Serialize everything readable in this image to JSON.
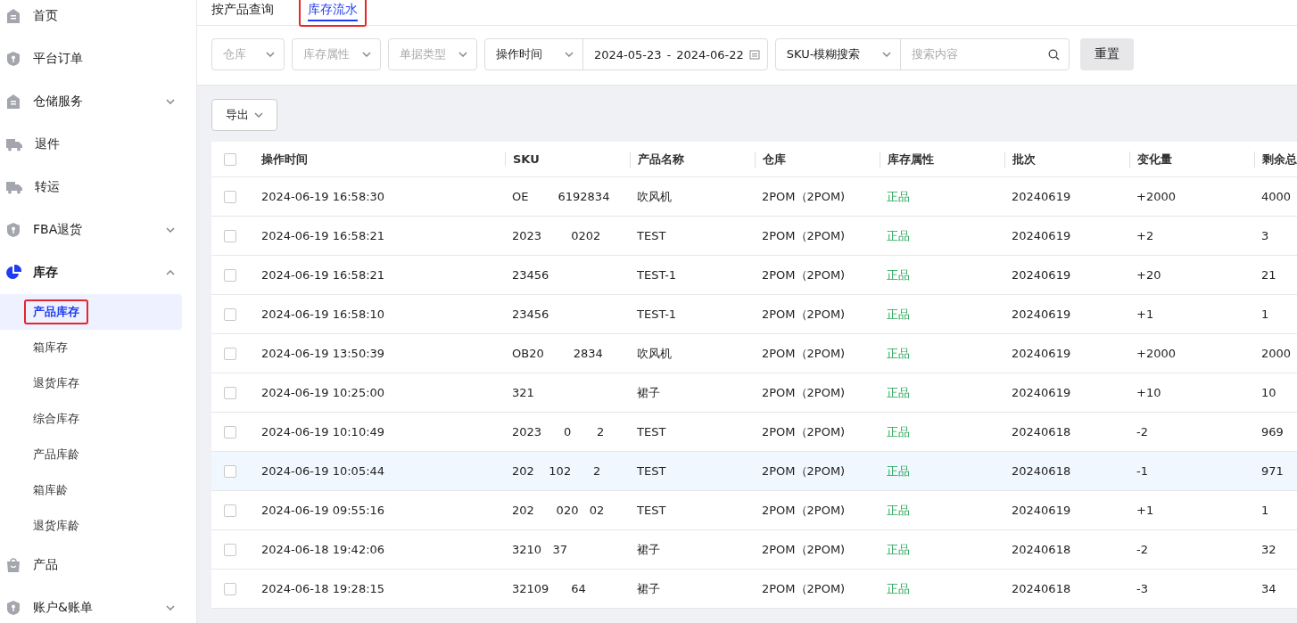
{
  "sidebar": {
    "items": [
      {
        "label": "首页",
        "active": false
      },
      {
        "label": "平台订单",
        "active": false
      },
      {
        "label": "仓储服务",
        "expanded": false,
        "active": false
      },
      {
        "label": "退件",
        "active": false
      },
      {
        "label": "转运",
        "active": false
      },
      {
        "label": "FBA退货",
        "expanded": false,
        "active": false
      },
      {
        "label": "库存",
        "expanded": true,
        "active": true,
        "children": [
          {
            "label": "产品库存",
            "selected": true,
            "annotated": true
          },
          {
            "label": "箱库存",
            "selected": false
          },
          {
            "label": "退货库存",
            "selected": false
          },
          {
            "label": "综合库存",
            "selected": false
          },
          {
            "label": "产品库龄",
            "selected": false
          },
          {
            "label": "箱库龄",
            "selected": false
          },
          {
            "label": "退货库龄",
            "selected": false
          }
        ]
      },
      {
        "label": "产品",
        "active": false
      },
      {
        "label": "账户&账单",
        "expanded": false,
        "active": false
      }
    ]
  },
  "tabs": [
    {
      "label": "按产品查询",
      "selected": false
    },
    {
      "label": "库存流水",
      "selected": true,
      "annotated": true
    }
  ],
  "filters": {
    "selects": [
      {
        "placeholder": "仓库"
      },
      {
        "placeholder": "库存属性"
      },
      {
        "placeholder": "单据类型"
      }
    ],
    "time_type": "操作时间",
    "date_start": "2024-05-23",
    "date_separator": "-",
    "date_end": "2024-06-22",
    "search_type": "SKU-模糊搜索",
    "search_placeholder": "搜索内容",
    "reset": "重置"
  },
  "export": "导出",
  "table": {
    "select_all_checked": false,
    "columns": [
      "操作时间",
      "SKU",
      "产品名称",
      "仓库",
      "库存属性",
      "批次",
      "变化量",
      "剩余总"
    ],
    "rows": [
      {
        "cells": [
          "2024-06-19 16:58:30",
          "OE        6192834",
          "吹风机",
          "2POM（2POM)",
          "正品",
          "20240619",
          "+2000",
          "4000"
        ],
        "checked": false,
        "highlighted": false
      },
      {
        "cells": [
          "2024-06-19 16:58:21",
          "2023        0202",
          "TEST",
          "2POM（2POM)",
          "正品",
          "20240619",
          "+2",
          "3"
        ],
        "checked": false,
        "highlighted": false
      },
      {
        "cells": [
          "2024-06-19 16:58:21",
          "23456",
          "TEST-1",
          "2POM（2POM)",
          "正品",
          "20240619",
          "+20",
          "21"
        ],
        "checked": false,
        "highlighted": false
      },
      {
        "cells": [
          "2024-06-19 16:58:10",
          "23456",
          "TEST-1",
          "2POM（2POM)",
          "正品",
          "20240619",
          "+1",
          "1"
        ],
        "checked": false,
        "highlighted": false
      },
      {
        "cells": [
          "2024-06-19 13:50:39",
          "OB20        2834",
          "吹风机",
          "2POM（2POM)",
          "正品",
          "20240619",
          "+2000",
          "2000"
        ],
        "checked": false,
        "highlighted": false
      },
      {
        "cells": [
          "2024-06-19 10:25:00",
          "321",
          "裙子",
          "2POM（2POM)",
          "正品",
          "20240619",
          "+10",
          "10"
        ],
        "checked": false,
        "highlighted": false
      },
      {
        "cells": [
          "2024-06-19 10:10:49",
          "2023      0       2",
          "TEST",
          "2POM（2POM)",
          "正品",
          "20240618",
          "-2",
          "969"
        ],
        "checked": false,
        "highlighted": false
      },
      {
        "cells": [
          "2024-06-19 10:05:44",
          "202    102      2",
          "TEST",
          "2POM（2POM)",
          "正品",
          "20240618",
          "-1",
          "971"
        ],
        "checked": false,
        "highlighted": true
      },
      {
        "cells": [
          "2024-06-19 09:55:16",
          "202      020   02",
          "TEST",
          "2POM（2POM)",
          "正品",
          "20240619",
          "+1",
          "1"
        ],
        "checked": false,
        "highlighted": false
      },
      {
        "cells": [
          "2024-06-18 19:42:06",
          "3210   37",
          "裙子",
          "2POM（2POM)",
          "正品",
          "20240618",
          "-2",
          "32"
        ],
        "checked": false,
        "highlighted": false
      },
      {
        "cells": [
          "2024-06-18 19:28:15",
          "32109      64",
          "裙子",
          "2POM（2POM)",
          "正品",
          "20240618",
          "-3",
          "34"
        ],
        "checked": false,
        "highlighted": false
      }
    ]
  }
}
